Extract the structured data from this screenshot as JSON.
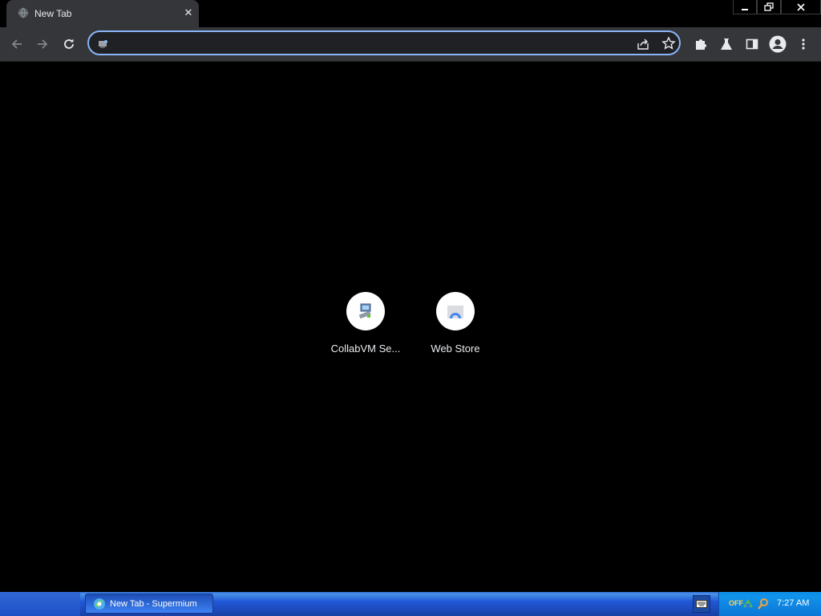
{
  "browser": {
    "tab": {
      "title": "New Tab",
      "close_glyph": "✕",
      "favicon": "globe-icon"
    },
    "window_controls": [
      "minimize-icon",
      "restore-icon",
      "close-icon"
    ],
    "toolbar": {
      "buttons": [
        "back-arrow-icon",
        "forward-arrow-icon",
        "reload-icon"
      ],
      "omnibox": {
        "value": "",
        "placeholder": "",
        "accent": "#8ab4f8"
      },
      "omnibox_icons": [
        "share-icon",
        "bookmark-star-icon"
      ],
      "right_buttons": [
        "extensions-puzzle-icon",
        "labs-flask-icon",
        "side-panel-icon",
        "profile-avatar-icon",
        "menu-kebab-icon"
      ]
    }
  },
  "new_tab_page": {
    "shortcuts": [
      {
        "label": "CollabVM Se...",
        "icon": "collabvm-computer-icon"
      },
      {
        "label": "Web Store",
        "icon": "web-store-icon"
      }
    ]
  },
  "taskbar": {
    "task_button": {
      "label": "New Tab - Supermium",
      "icon": "supermium-icon"
    },
    "tray": {
      "off_label": "OFF",
      "clock": "7:27 AM",
      "icons": [
        "network-icon",
        "search-magnifier-icon"
      ]
    }
  },
  "colors": {
    "toolbar": "#35363a",
    "omnibox_bg": "#202124",
    "text": "#e8eaed",
    "page_bg": "#000000",
    "taskbar": "#245edb"
  }
}
